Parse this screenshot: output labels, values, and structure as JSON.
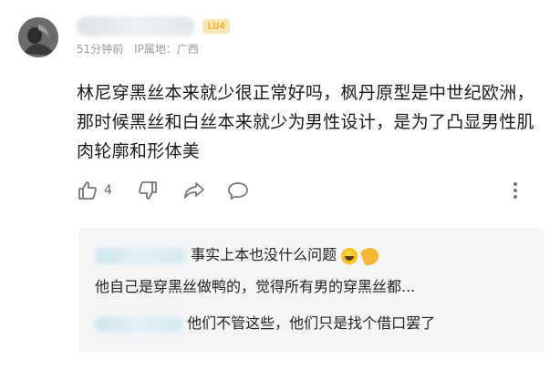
{
  "comment": {
    "level_badge": "LU4",
    "time": "51分钟前",
    "ip_location": "IP属地：广西",
    "text": "林尼穿黑丝本来就少很正常好吗，枫丹原型是中世纪欧洲，那时候黑丝和白丝本来就少为男性设计，是为了凸显男性肌肉轮廓和形体美",
    "like_count": "4"
  },
  "icons": {
    "like": "thumbs-up-icon",
    "dislike": "thumbs-down-icon",
    "share": "share-icon",
    "reply": "reply-bubble-icon",
    "more": "more-vertical-icon"
  },
  "replies": [
    {
      "text": "事实上本也没什么问题"
    },
    {
      "text": "他自己是穿黑丝做鸭的，觉得所有男的穿黑丝都..."
    },
    {
      "text": "他们不管这些，他们只是找个借口罢了"
    }
  ],
  "colors": {
    "meta_gray": "#9a9a9a",
    "reply_bg": "#f4f5f7",
    "badge_text": "#f3b43c",
    "badge_bg": "#f6e7b5"
  }
}
